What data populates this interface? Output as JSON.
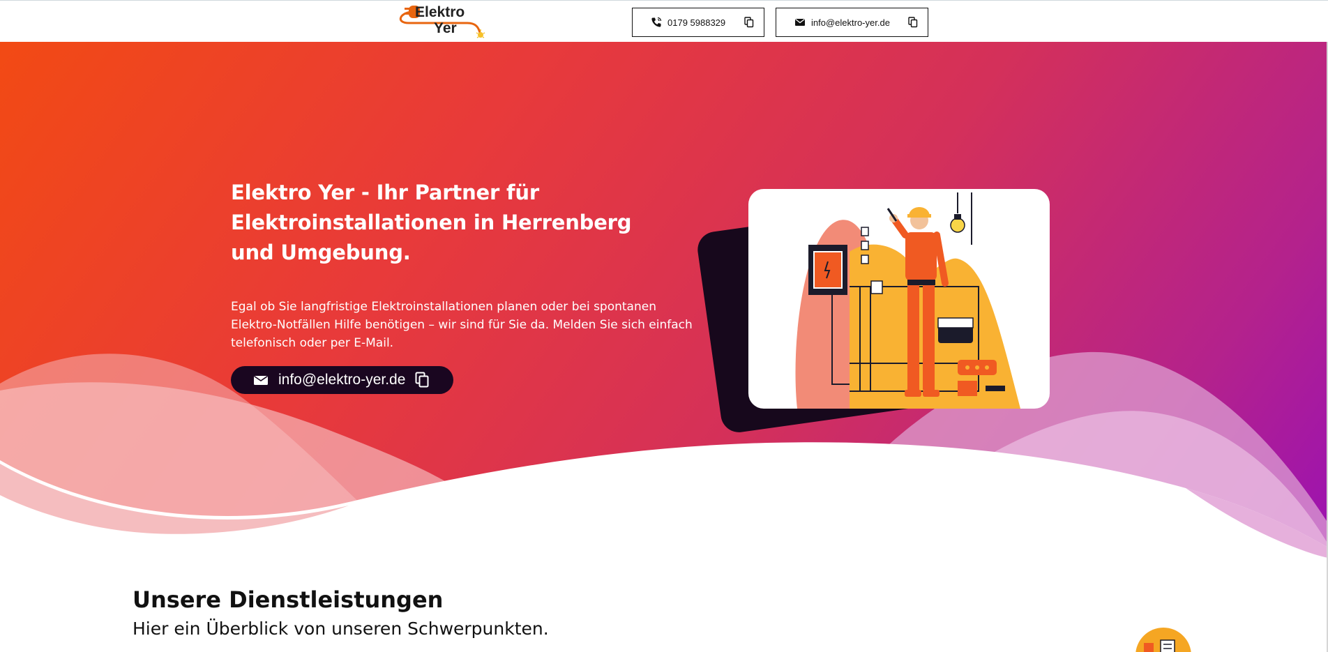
{
  "header": {
    "logo": {
      "word1": "Elektro",
      "word2": "Yer"
    },
    "phone": {
      "icon": "phone-icon",
      "text": "0179 5988329",
      "copy_icon": "copy-icon"
    },
    "email": {
      "icon": "mail-icon",
      "text": "info@elektro-yer.de",
      "copy_icon": "copy-icon"
    }
  },
  "hero": {
    "title": "Elektro Yer - Ihr Partner für Elektroinstallationen in Herrenberg und Umgebung.",
    "text": "Egal ob Sie langfristige Elektroinstallationen planen oder bei spontanen Elektro-Notfällen Hilfe benötigen – wir sind für Sie da. Melden Sie sich einfach telefonisch oder per E-Mail.",
    "email_button": {
      "icon": "mail-icon",
      "text": "info@elektro-yer.de",
      "copy_icon": "copy-icon"
    },
    "illustration": "electrician-illustration",
    "colors": {
      "gradient_start": "#f24a14",
      "gradient_end": "#9b12b2",
      "button_bg": "#1a0620",
      "illustration_orange": "#f05a22",
      "illustration_yellow": "#f9b233"
    }
  },
  "services": {
    "title": "Unsere Dienstleistungen",
    "subtitle": "Hier ein Überblick von unseren Schwerpunkten."
  }
}
